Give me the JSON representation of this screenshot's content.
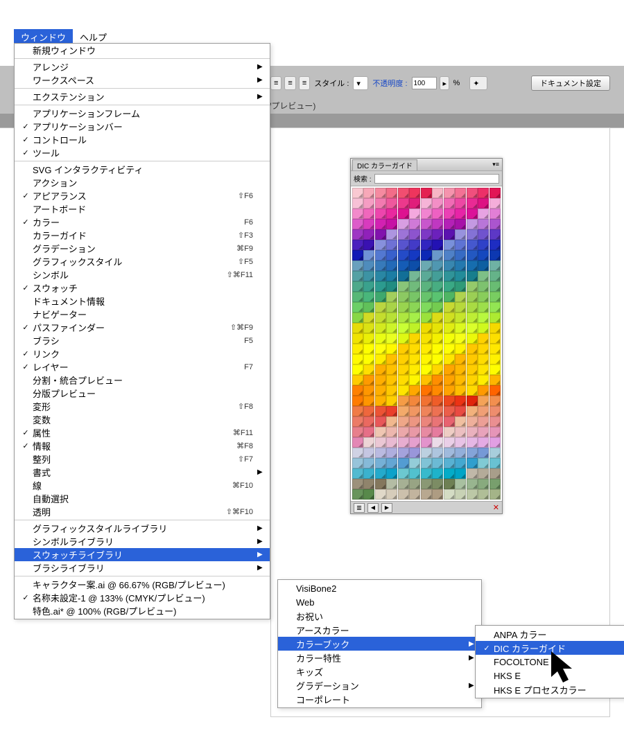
{
  "menubar": {
    "window": "ウィンドウ",
    "help": "ヘルプ"
  },
  "toolbar": {
    "style": "スタイル :",
    "opacity": "不透明度 :",
    "opacity_val": "100",
    "pct": "%",
    "doc_settings": "ドキュメント設定"
  },
  "doc_title": "/プレビュー)",
  "panel": {
    "tab": "DIC カラーガイド",
    "search": "検索 :"
  },
  "window_menu": [
    {
      "type": "item",
      "label": "新規ウィンドウ"
    },
    {
      "type": "sep"
    },
    {
      "type": "item",
      "label": "アレンジ",
      "arrow": true
    },
    {
      "type": "item",
      "label": "ワークスペース",
      "arrow": true
    },
    {
      "type": "sep"
    },
    {
      "type": "item",
      "label": "エクステンション",
      "arrow": true
    },
    {
      "type": "sep"
    },
    {
      "type": "item",
      "label": "アプリケーションフレーム"
    },
    {
      "type": "item",
      "label": "アプリケーションバー",
      "check": true
    },
    {
      "type": "item",
      "label": "コントロール",
      "check": true
    },
    {
      "type": "item",
      "label": "ツール",
      "check": true
    },
    {
      "type": "sep"
    },
    {
      "type": "item",
      "label": "SVG インタラクティビティ"
    },
    {
      "type": "item",
      "label": "アクション"
    },
    {
      "type": "item",
      "label": "アピアランス",
      "check": true,
      "shortcut": "⇧F6"
    },
    {
      "type": "item",
      "label": "アートボード"
    },
    {
      "type": "item",
      "label": "カラー",
      "check": true,
      "shortcut": "F6"
    },
    {
      "type": "item",
      "label": "カラーガイド",
      "shortcut": "⇧F3"
    },
    {
      "type": "item",
      "label": "グラデーション",
      "shortcut": "⌘F9"
    },
    {
      "type": "item",
      "label": "グラフィックスタイル",
      "shortcut": "⇧F5"
    },
    {
      "type": "item",
      "label": "シンボル",
      "shortcut": "⇧⌘F11"
    },
    {
      "type": "item",
      "label": "スウォッチ",
      "check": true
    },
    {
      "type": "item",
      "label": "ドキュメント情報"
    },
    {
      "type": "item",
      "label": "ナビゲーター"
    },
    {
      "type": "item",
      "label": "パスファインダー",
      "check": true,
      "shortcut": "⇧⌘F9"
    },
    {
      "type": "item",
      "label": "ブラシ",
      "shortcut": "F5"
    },
    {
      "type": "item",
      "label": "リンク",
      "check": true
    },
    {
      "type": "item",
      "label": "レイヤー",
      "check": true,
      "shortcut": "F7"
    },
    {
      "type": "item",
      "label": "分割・統合プレビュー"
    },
    {
      "type": "item",
      "label": "分版プレビュー"
    },
    {
      "type": "item",
      "label": "変形",
      "shortcut": "⇧F8"
    },
    {
      "type": "item",
      "label": "変数"
    },
    {
      "type": "item",
      "label": "属性",
      "check": true,
      "shortcut": "⌘F11"
    },
    {
      "type": "item",
      "label": "情報",
      "check": true,
      "shortcut": "⌘F8"
    },
    {
      "type": "item",
      "label": "整列",
      "shortcut": "⇧F7"
    },
    {
      "type": "item",
      "label": "書式",
      "arrow": true
    },
    {
      "type": "item",
      "label": "線",
      "shortcut": "⌘F10"
    },
    {
      "type": "item",
      "label": "自動選択"
    },
    {
      "type": "item",
      "label": "透明",
      "shortcut": "⇧⌘F10"
    },
    {
      "type": "sep"
    },
    {
      "type": "item",
      "label": "グラフィックスタイルライブラリ",
      "arrow": true
    },
    {
      "type": "item",
      "label": "シンボルライブラリ",
      "arrow": true
    },
    {
      "type": "item",
      "label": "スウォッチライブラリ",
      "arrow": true,
      "highlighted": true
    },
    {
      "type": "item",
      "label": "ブラシライブラリ",
      "arrow": true
    },
    {
      "type": "sep"
    },
    {
      "type": "item",
      "label": "キャラクター案.ai @ 66.67% (RGB/プレビュー)"
    },
    {
      "type": "item",
      "label": "名称未設定-1 @ 133% (CMYK/プレビュー)",
      "check": true
    },
    {
      "type": "item",
      "label": "特色.ai* @ 100% (RGB/プレビュー)"
    }
  ],
  "submenu1": [
    {
      "label": "VisiBone2"
    },
    {
      "label": "Web"
    },
    {
      "label": "お祝い"
    },
    {
      "label": "アースカラー"
    },
    {
      "label": "カラーブック",
      "arrow": true,
      "highlighted": true
    },
    {
      "label": "カラー特性",
      "arrow": true
    },
    {
      "label": "キッズ"
    },
    {
      "label": "グラデーション",
      "arrow": true
    },
    {
      "label": "コーポレート"
    }
  ],
  "submenu2": [
    {
      "label": "ANPA カラー"
    },
    {
      "label": "DIC カラーガイド",
      "check": true,
      "highlighted": true
    },
    {
      "label": "FOCOLTONE"
    },
    {
      "label": "HKS E"
    },
    {
      "label": "HKS E プロセスカラー"
    }
  ],
  "swatch_colors": [
    "#f9c9d2",
    "#f7a8b8",
    "#f58aa0",
    "#f36c88",
    "#f14e70",
    "#ee355d",
    "#e42051",
    "#f7b6c5",
    "#f593ad",
    "#f37195",
    "#f04f7d",
    "#ec3068",
    "#e21556",
    "#f7c1d6",
    "#f59dc3",
    "#f27ab0",
    "#ef589d",
    "#ec398c",
    "#e01e7b",
    "#f6b4d7",
    "#f38fc6",
    "#f06bb5",
    "#ed48a4",
    "#e92a94",
    "#dd1283",
    "#f5aeda",
    "#f38acb",
    "#f067bc",
    "#ed45ad",
    "#e9289f",
    "#dd1290",
    "#f4a8de",
    "#f184d0",
    "#ee61c2",
    "#eb40b4",
    "#e724a7",
    "#db1299",
    "#e7a3e2",
    "#e27fd6",
    "#dd5cca",
    "#d83bbe",
    "#d221b2",
    "#c611a5",
    "#d89ee2",
    "#d07ad7",
    "#c857cc",
    "#bf38c1",
    "#b421b6",
    "#a712a9",
    "#c499e2",
    "#b876d8",
    "#ab55ce",
    "#9e37c4",
    "#9021ba",
    "#8112ad",
    "#ad95e0",
    "#9d74d7",
    "#8d54ce",
    "#7d38c5",
    "#6c21bc",
    "#5b12af",
    "#9892de",
    "#8472d6",
    "#7053ce",
    "#5d38c6",
    "#4b21be",
    "#3a12b1",
    "#8790dc",
    "#6f71d5",
    "#5854ce",
    "#433bc7",
    "#3125c0",
    "#2312b3",
    "#7990da",
    "#5e73d4",
    "#4558ce",
    "#2f41c8",
    "#1e2dc2",
    "#1219b5",
    "#6f92d6",
    "#5378d1",
    "#3960cc",
    "#244bc7",
    "#1539c2",
    "#0d28b5",
    "#6a98ca",
    "#4f81c7",
    "#376bc4",
    "#2358c1",
    "#1548be",
    "#0d38b1",
    "#6aa0be",
    "#4f8cbc",
    "#377aba",
    "#236ab8",
    "#155cb6",
    "#0d4ea9",
    "#6ba9b2",
    "#5097b1",
    "#3887b0",
    "#2479af",
    "#166dae",
    "#0e5fa1",
    "#6fb1a4",
    "#55a1a4",
    "#3d93a4",
    "#2987a4",
    "#1b7da4",
    "#126f97",
    "#75b896",
    "#5baa97",
    "#449e98",
    "#309499",
    "#228c9a",
    "#177e8d",
    "#7ebf87",
    "#65b389",
    "#4ea98b",
    "#3aa18d",
    "#2c9b8f",
    "#218d82",
    "#89c579",
    "#71bb7c",
    "#5bb37f",
    "#48ad82",
    "#3aa985",
    "#2f9b78",
    "#95ca6b",
    "#7ec26f",
    "#69bc73",
    "#57b877",
    "#49b67b",
    "#3ea86e",
    "#a2cf5d",
    "#8cc962",
    "#78c567",
    "#67c36c",
    "#5ac371",
    "#4fb564",
    "#afd34f",
    "#9bcf55",
    "#89cd5b",
    "#79cd61",
    "#6ccf67",
    "#61c15a",
    "#bbd641",
    "#a9d448",
    "#99d44f",
    "#8bd656",
    "#7fda5d",
    "#74cc50",
    "#c7d933",
    "#b7d93b",
    "#a9db43",
    "#9ddf4b",
    "#93e553",
    "#88d746",
    "#d2db25",
    "#c4dd2e",
    "#b8e137",
    "#aee740",
    "#a6ef49",
    "#9be13c",
    "#dcdc17",
    "#d0e021",
    "#c6e62b",
    "#beee35",
    "#b8f83f",
    "#adea32",
    "#e5dc09",
    "#dbe214",
    "#d3ea1f",
    "#cdf42a",
    "#c9ff35",
    "#bef128",
    "#eedb00",
    "#e6e307",
    "#e0ed13",
    "#dcf91f",
    "#daff2b",
    "#cff91e",
    "#f5d900",
    "#efe300",
    "#ebef07",
    "#e9fd14",
    "#e9ff21",
    "#def914",
    "#fad600",
    "#f6e200",
    "#f4f000",
    "#f4ff09",
    "#f6ff17",
    "#ebf90a",
    "#fed200",
    "#fcdf00",
    "#fcee00",
    "#feff00",
    "#ffff0e",
    "#fff900",
    "#ffcd00",
    "#ffdb00",
    "#ffeb00",
    "#fffd00",
    "#ffff06",
    "#fff400",
    "#ffc700",
    "#ffd600",
    "#ffe700",
    "#fffa00",
    "#ffff00",
    "#ffee00",
    "#ffc000",
    "#ffd000",
    "#ffe200",
    "#fff600",
    "#ffff00",
    "#ffe700",
    "#ffb800",
    "#ffc900",
    "#ffdc00",
    "#fff100",
    "#ffff00",
    "#ffdf00",
    "#ffaf00",
    "#ffc100",
    "#ffd500",
    "#ffeb00",
    "#ffff00",
    "#ffd600",
    "#ffa500",
    "#ffb800",
    "#ffcd00",
    "#ffe400",
    "#fffd00",
    "#ffcc00",
    "#ff9a00",
    "#ffae00",
    "#ffc400",
    "#ffdc00",
    "#fff600",
    "#ffc100",
    "#ff8e00",
    "#ffa300",
    "#ffba00",
    "#ffd300",
    "#ffee00",
    "#ffb500",
    "#ff8100",
    "#ff9700",
    "#ffaf00",
    "#ffc900",
    "#ffe500",
    "#ffa800",
    "#ff7300",
    "#ff8a00",
    "#ffa300",
    "#ffbe00",
    "#ffdb00",
    "#ff9a00",
    "#ff6400",
    "#ff7c00",
    "#ff9600",
    "#ffb200",
    "#ffd000",
    "#f59c46",
    "#f3873c",
    "#f17232",
    "#ef5d28",
    "#ed481e",
    "#eb3314",
    "#e0250c",
    "#f4a358",
    "#f28f4f",
    "#f07b46",
    "#ee673d",
    "#ec5334",
    "#ea3f2b",
    "#f3aa6a",
    "#f19762",
    "#ef845a",
    "#ed7152",
    "#eb5e4a",
    "#e94b42",
    "#f2b17c",
    "#f09f75",
    "#ee8d6e",
    "#ec7b67",
    "#ea6960",
    "#e85759",
    "#f1b88e",
    "#efa788",
    "#ed9682",
    "#eb857c",
    "#e97476",
    "#e76370",
    "#f0bfa0",
    "#eeaf9b",
    "#ec9f96",
    "#ea8f91",
    "#e87f8c",
    "#e66f87",
    "#efc6b2",
    "#edb7ae",
    "#eba8aa",
    "#e999a6",
    "#e78aa2",
    "#e57b9e",
    "#eecdc4",
    "#ecbfc1",
    "#eab1be",
    "#e8a3bb",
    "#e695b8",
    "#e487b5",
    "#edd4d6",
    "#ebc7d4",
    "#e9bad2",
    "#e7add0",
    "#e5a0ce",
    "#e393cc",
    "#ecdbe8",
    "#eacfe7",
    "#e8c3e6",
    "#e6b7e5",
    "#e4abe4",
    "#e29fe3",
    "#d0d2e4",
    "#c5c6e2",
    "#babae0",
    "#afaede",
    "#a4a2dc",
    "#9996da",
    "#bcd0e0",
    "#aec5de",
    "#a0badc",
    "#92afda",
    "#84a4d8",
    "#7699d6",
    "#a8cedc",
    "#97c4da",
    "#86bad8",
    "#75b0d6",
    "#64a6d4",
    "#539cd2",
    "#94ccd8",
    "#80c3d6",
    "#6cbad4",
    "#58b1d2",
    "#44a8d0",
    "#309fce",
    "#80cad4",
    "#69c2d2",
    "#52bad0",
    "#3bb2ce",
    "#24aacc",
    "#0da2ca",
    "#6cc8d0",
    "#52c1ce",
    "#38bacc",
    "#1eb3ca",
    "#04acc8",
    "#00a5c6",
    "#c0b8a8",
    "#b4ab99",
    "#a89e8a",
    "#9c917b",
    "#90846c",
    "#84775d",
    "#b4bca4",
    "#a6b094",
    "#98a484",
    "#8a9874",
    "#7c8c64",
    "#6e8054",
    "#a8c0a0",
    "#98b58f",
    "#88aa7e",
    "#789f6d",
    "#68945c",
    "#58894b",
    "#e0d8c8",
    "#d6ccba",
    "#ccc0ac",
    "#c2b49e",
    "#b8a890",
    "#ae9c82",
    "#d4dcc4",
    "#c8d2b5",
    "#bcc8a6",
    "#b0be97",
    "#a4b488"
  ]
}
